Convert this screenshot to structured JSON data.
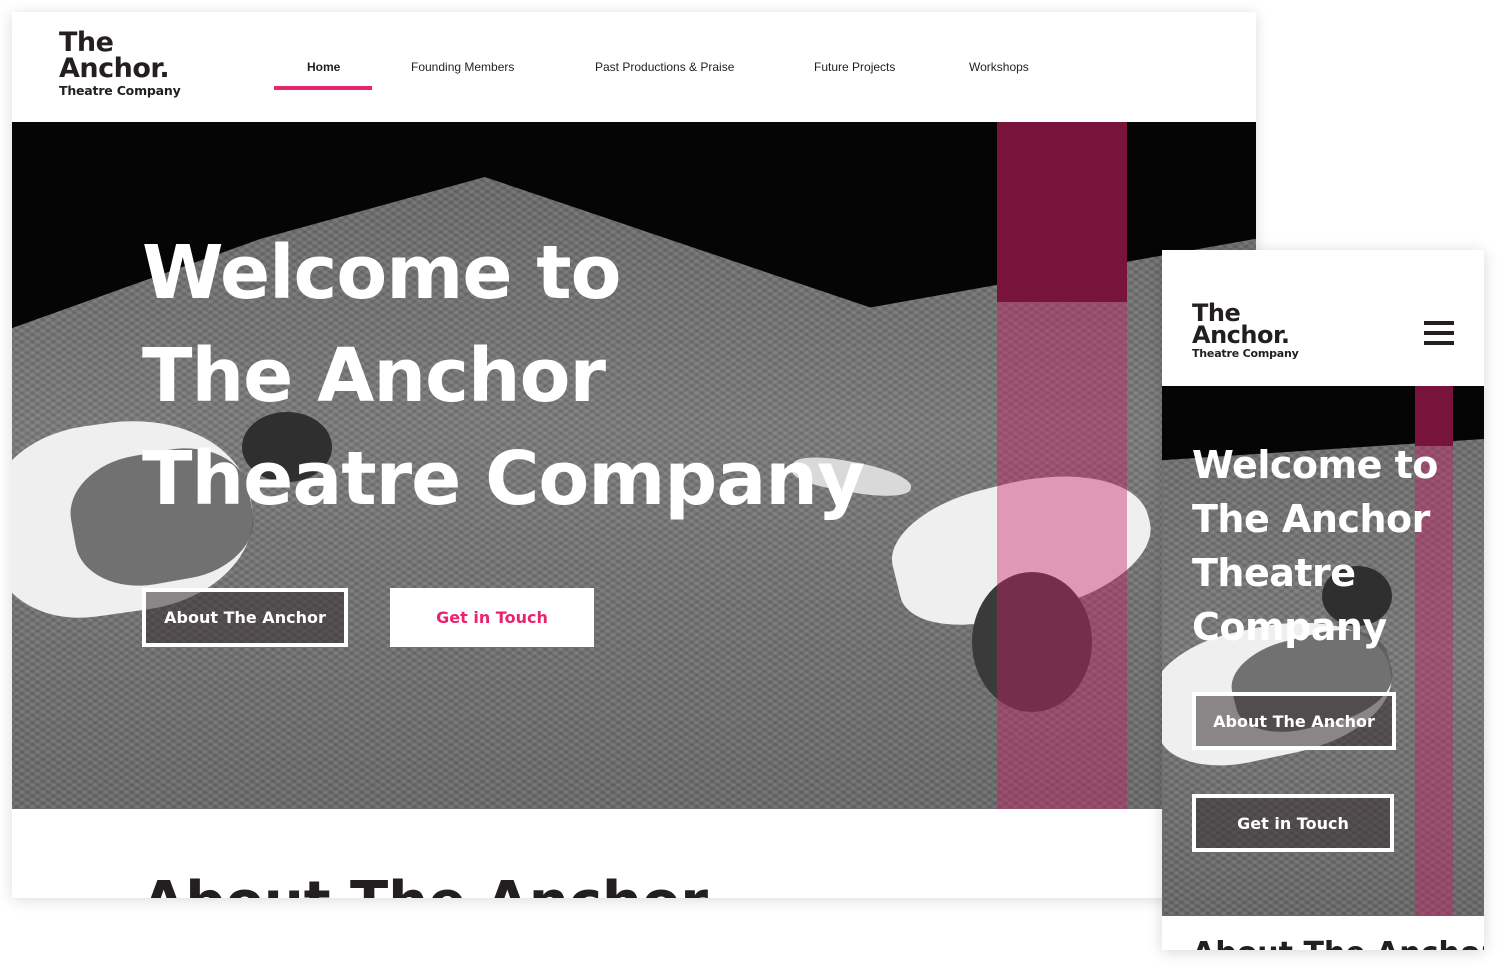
{
  "logo": {
    "line1": "The",
    "line2": "Anchor.",
    "line3": "Theatre Company"
  },
  "nav": {
    "items": [
      {
        "label": "Home",
        "active": true
      },
      {
        "label": "Founding Members",
        "active": false
      },
      {
        "label": "Past Productions & Praise",
        "active": false
      },
      {
        "label": "Future Projects",
        "active": false
      },
      {
        "label": "Workshops",
        "active": false
      }
    ]
  },
  "hero": {
    "title_lines": [
      "Welcome to",
      "The Anchor",
      "Theatre Company"
    ],
    "mobile_title_lines": [
      "Welcome to",
      "The Anchor",
      "Theatre",
      "Company"
    ],
    "primary_button": "About The Anchor",
    "secondary_button": "Get in Touch"
  },
  "section": {
    "title": "About The Anchor"
  },
  "colors": {
    "accent": "#e8246d",
    "text": "#231f20",
    "background": "#ffffff"
  },
  "icons": {
    "menu": "hamburger-menu-icon"
  }
}
